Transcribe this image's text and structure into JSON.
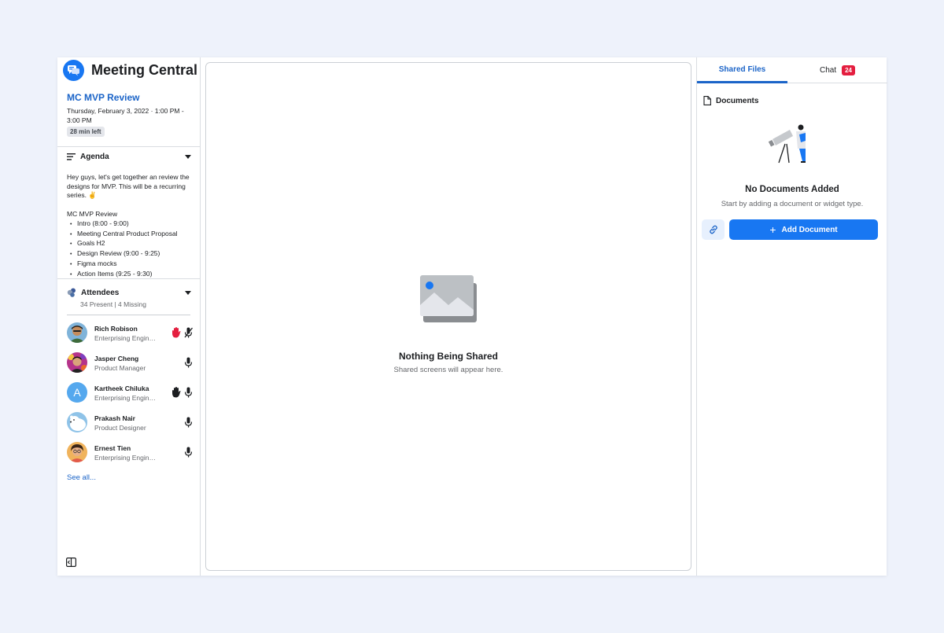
{
  "app": {
    "title": "Meeting Central"
  },
  "meeting": {
    "title": "MC MVP Review",
    "date": "Thursday, February 3, 2022 · 1:00 PM - 3:00 PM",
    "time_left": "28 min left"
  },
  "agenda": {
    "label": "Agenda",
    "description": "Hey guys, let's get together an review the designs for MVP. This will be a recurring series. ✌",
    "list_title": "MC MVP Review",
    "items": [
      "Intro (8:00 - 9:00)",
      "Meeting Central Product Proposal",
      "Goals H2",
      "Design Review (9:00 - 9:25)",
      "Figma mocks",
      "Action Items (9:25 - 9:30)"
    ]
  },
  "attendees": {
    "label": "Attendees",
    "summary": "34 Present | 4 Missing",
    "people": [
      {
        "name": "Rich Robison",
        "role": "Enterprising Engineer",
        "hand": true,
        "hand_color": "#e41e3f",
        "mic_muted": true
      },
      {
        "name": "Jasper Cheng",
        "role": "Product Manager",
        "hand": false,
        "mic_muted": false
      },
      {
        "name": "Kartheek Chiluka",
        "role": "Enterprising Engineer",
        "hand": true,
        "hand_color": "#1c1e21",
        "mic_muted": false,
        "initial": "A"
      },
      {
        "name": "Prakash Nair",
        "role": "Product Designer",
        "hand": false,
        "mic_muted": false
      },
      {
        "name": "Ernest Tien",
        "role": "Enterprising Engineer",
        "hand": false,
        "mic_muted": false
      }
    ],
    "see_all": "See all..."
  },
  "stage": {
    "title": "Nothing Being Shared",
    "subtitle": "Shared screens will appear here."
  },
  "right_panel": {
    "tabs": [
      {
        "label": "Shared Files",
        "active": true
      },
      {
        "label": "Chat",
        "badge": "24"
      }
    ],
    "documents_label": "Documents",
    "empty_title": "No Documents Added",
    "empty_subtitle": "Start by adding a document or widget type.",
    "add_button": "Add Document"
  },
  "colors": {
    "accent": "#1877f2",
    "link": "#1b64c8",
    "badge": "#e41e3f",
    "background": "#eef2fb"
  },
  "icons": {
    "logo": "chat-bubbles-icon",
    "agenda": "lines-icon",
    "attendees": "people-icon",
    "documents": "file-icon",
    "link": "link-icon",
    "mic": "microphone-icon",
    "mic_muted": "microphone-muted-icon",
    "hand": "raised-hand-icon",
    "collapse": "sidebar-collapse-icon",
    "placeholder": "image-placeholder-icon"
  }
}
